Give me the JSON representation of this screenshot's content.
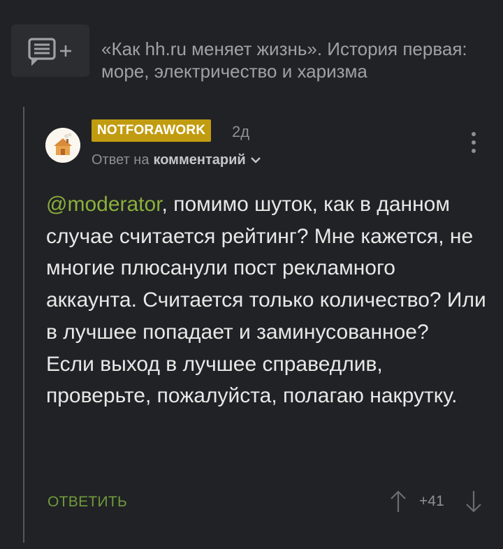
{
  "post": {
    "title": "«Как hh.ru меняет жизнь». История первая: море, электричество и харизма",
    "icon": "comment-add-icon"
  },
  "comment": {
    "author": "NOTFORAWORK",
    "time_ago": "2д",
    "reply_prefix": "Ответ на",
    "reply_target": "комментарий",
    "mention": "@moderator",
    "body_part1_after_mention": ", помимо шуток, как в данном случае считается рейтинг? Мне кажется, не многие плюсанули пост рекламного аккаунта. Считается только количество? Или в лучшее попадает и заминусованное?",
    "body_part2": "Если выход в лучшее справедлив, проверьте, пожалуйста, полагаю накрутку.",
    "reply_label": "ОТВЕТИТЬ",
    "rating": "+41"
  },
  "colors": {
    "background": "#212225",
    "badge": "#c29c10",
    "mention": "#8ab03b",
    "reply_link": "#6f9b3b"
  }
}
